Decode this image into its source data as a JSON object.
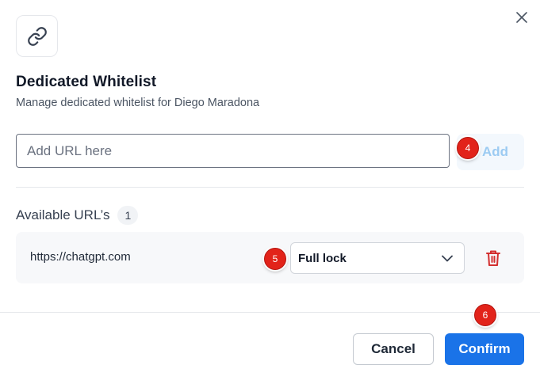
{
  "dialog": {
    "title": "Dedicated Whitelist",
    "subtitle": "Manage dedicated whitelist for Diego Maradona",
    "header_icon": "link-icon",
    "close_icon": "close-icon"
  },
  "url_input": {
    "placeholder": "Add URL here",
    "value": ""
  },
  "add_button": {
    "label": "Add"
  },
  "available": {
    "title": "Available URL’s",
    "count": "1",
    "items": [
      {
        "url": "https://chatgpt.com",
        "lock_mode": "Full lock"
      }
    ]
  },
  "markers": {
    "add": "4",
    "lock_select": "5",
    "confirm": "6"
  },
  "footer": {
    "cancel_label": "Cancel",
    "confirm_label": "Confirm"
  },
  "colors": {
    "primary": "#1a73e8",
    "add_text": "#9ccbf2",
    "delete": "#d32f2f",
    "marker": "#e2231a"
  }
}
